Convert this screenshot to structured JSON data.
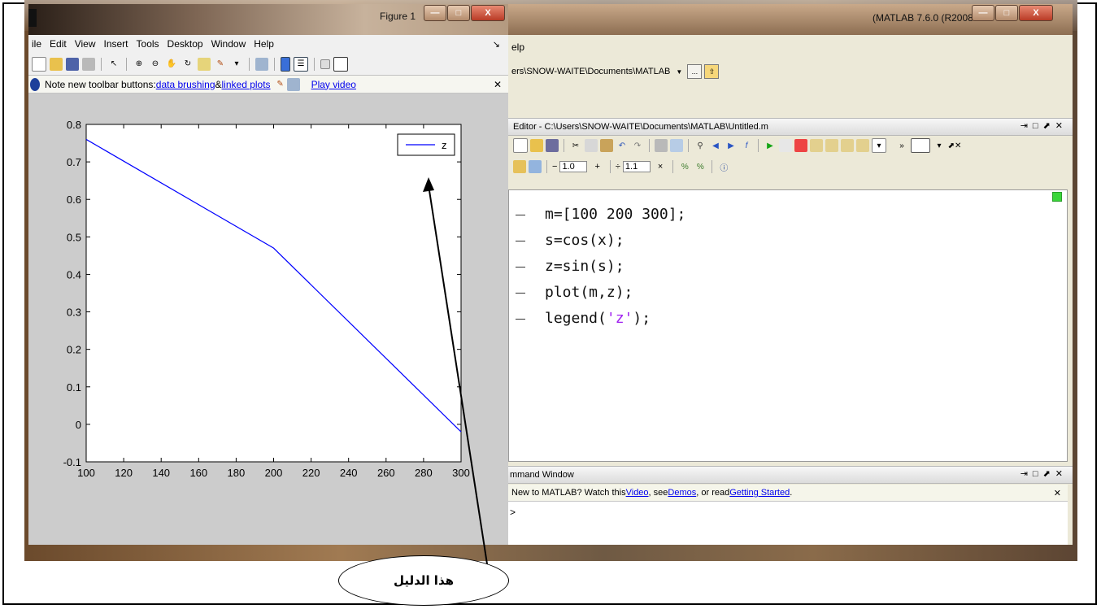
{
  "matlab": {
    "title": "(MATLAB 7.6.0 (R2008a",
    "menu": "elp",
    "current_folder": "ers\\SNOW-WAITE\\Documents\\MATLAB",
    "folder_browse": "...",
    "editor": {
      "title": "Editor - C:\\Users\\SNOW-WAITE\\Documents\\MATLAB\\Untitled.m",
      "cell_value1": "1.0",
      "cell_value2": "1.1",
      "minus": "−",
      "plus": "+",
      "divide": "÷",
      "times": "×",
      "code": [
        "m=[100 200 300];",
        "s=cos(x);",
        "z=sin(s);",
        "plot(m,z);",
        "legend('z');"
      ]
    },
    "command": {
      "title": "mmand Window",
      "info_prefix": "New to MATLAB? Watch this ",
      "info_video": "Video",
      "info_mid": ", see ",
      "info_demos": "Demos",
      "info_mid2": ", or read ",
      "info_gs": "Getting Started",
      "info_end": ".",
      "prompt": ">"
    }
  },
  "figure": {
    "title": "Figure 1",
    "menu": [
      "ile",
      "Edit",
      "View",
      "Insert",
      "Tools",
      "Desktop",
      "Window",
      "Help"
    ],
    "note_text": "Note new toolbar buttons: ",
    "note_link1": "data brushing",
    "note_amp": " & ",
    "note_link2": "linked plots",
    "note_video": "Play video"
  },
  "chart_data": {
    "type": "line",
    "x": [
      100,
      200,
      300
    ],
    "series": [
      {
        "name": "z",
        "values": [
          0.76,
          0.47,
          -0.02
        ],
        "color": "#0000ff"
      }
    ],
    "xlim": [
      100,
      300
    ],
    "ylim": [
      -0.1,
      0.8
    ],
    "xticks": [
      "100",
      "120",
      "140",
      "160",
      "180",
      "200",
      "220",
      "240",
      "260",
      "280",
      "300"
    ],
    "yticks": [
      "-0.1",
      "0",
      "0.1",
      "0.2",
      "0.3",
      "0.4",
      "0.5",
      "0.6",
      "0.7",
      "0.8"
    ],
    "legend": "top-right"
  },
  "annotation": {
    "label": "هذا الدليل"
  }
}
